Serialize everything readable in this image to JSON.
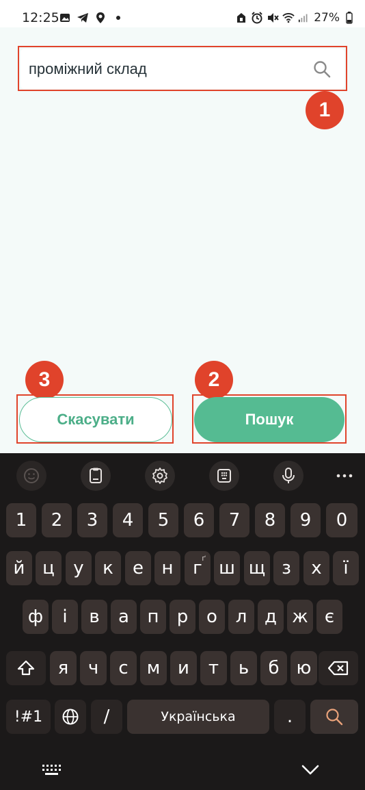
{
  "status_bar": {
    "time": "12:25",
    "battery": "27%"
  },
  "search": {
    "value": "проміжний склад",
    "icon": "search-icon"
  },
  "buttons": {
    "cancel_label": "Скасувати",
    "search_label": "Пошук"
  },
  "annotations": {
    "badge_1": "1",
    "badge_2": "2",
    "badge_3": "3",
    "color": "#e0432b"
  },
  "colors": {
    "accent": "#55bb92",
    "keyboard_bg": "#1b1919",
    "key_bg": "#3a3230"
  },
  "keyboard": {
    "toolbar_icons": [
      "emoji-icon",
      "clipboard-icon",
      "settings-icon",
      "keypad-icon",
      "microphone-icon",
      "more-icon"
    ],
    "row_numbers": [
      "1",
      "2",
      "3",
      "4",
      "5",
      "6",
      "7",
      "8",
      "9",
      "0"
    ],
    "row1": [
      "й",
      "ц",
      "у",
      "к",
      "е",
      "н",
      "г",
      "ш",
      "щ",
      "з",
      "х",
      "ї"
    ],
    "row1_alt_g": "ґ",
    "row2": [
      "ф",
      "і",
      "в",
      "а",
      "п",
      "р",
      "о",
      "л",
      "д",
      "ж",
      "є"
    ],
    "row3": [
      "я",
      "ч",
      "с",
      "м",
      "и",
      "т",
      "ь",
      "б",
      "ю"
    ],
    "symbols_label": "!#1",
    "slash_label": "/",
    "space_label": "Українська",
    "period_label": "."
  }
}
